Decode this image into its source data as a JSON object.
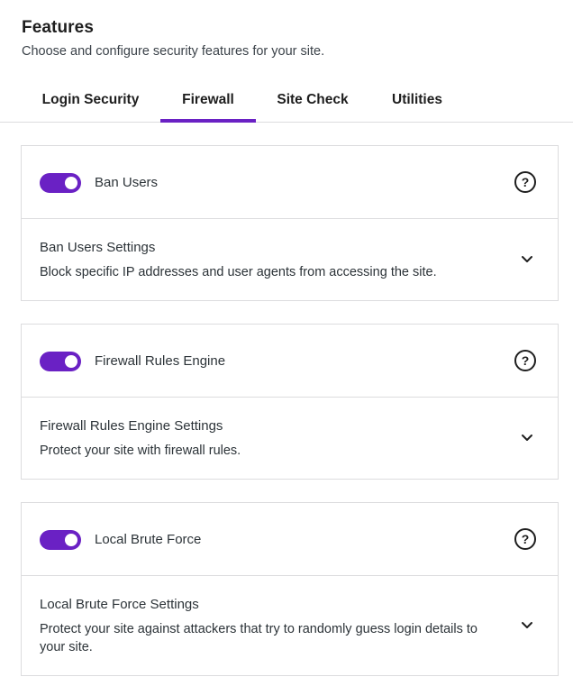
{
  "header": {
    "title": "Features",
    "subtitle": "Choose and configure security features for your site."
  },
  "tabs": [
    {
      "label": "Login Security",
      "active": false
    },
    {
      "label": "Firewall",
      "active": true
    },
    {
      "label": "Site Check",
      "active": false
    },
    {
      "label": "Utilities",
      "active": false
    }
  ],
  "accent_color": "#6a21c4",
  "features": [
    {
      "name": "Ban Users",
      "enabled": true,
      "help_icon": "question-circle",
      "settings_title": "Ban Users Settings",
      "settings_description": "Block specific IP addresses and user agents from accessing the site.",
      "expand_icon": "chevron-down"
    },
    {
      "name": "Firewall Rules Engine",
      "enabled": true,
      "help_icon": "question-circle",
      "settings_title": "Firewall Rules Engine Settings",
      "settings_description": "Protect your site with firewall rules.",
      "expand_icon": "chevron-down"
    },
    {
      "name": "Local Brute Force",
      "enabled": true,
      "help_icon": "question-circle",
      "settings_title": "Local Brute Force Settings",
      "settings_description": "Protect your site against attackers that try to randomly guess login details to your site.",
      "expand_icon": "chevron-down"
    }
  ]
}
